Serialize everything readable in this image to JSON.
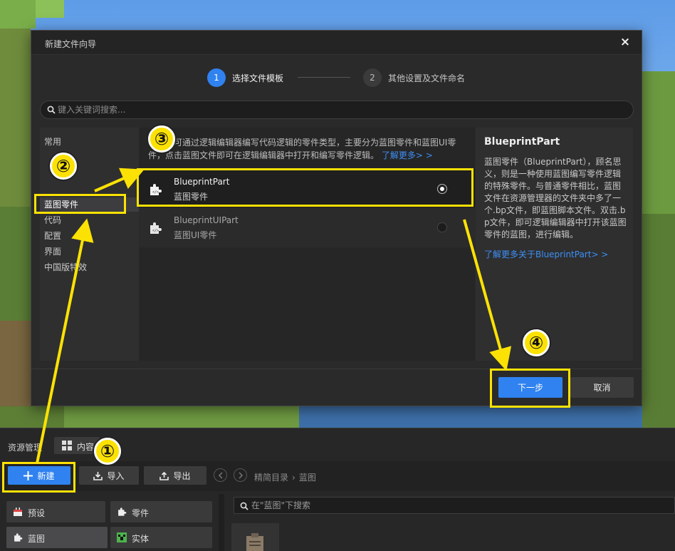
{
  "dialog": {
    "title": "新建文件向导",
    "close_label": "×",
    "steps": [
      {
        "num": "1",
        "label": "选择文件模板"
      },
      {
        "num": "2",
        "label": "其他设置及文件命名"
      }
    ],
    "search_placeholder": "键入关键词搜索...",
    "categories": [
      "常用",
      "蓝图零件",
      "代码",
      "配置",
      "界面",
      "中国版特效"
    ],
    "active_category": "蓝图零件",
    "list_description": "是一种可通过逻辑编辑器编写代码逻辑的零件类型，主要分为蓝图零件和蓝图UI零件，点击蓝图文件即可在逻辑编辑器中打开和编写零件逻辑。",
    "list_more_link": "了解更多> >",
    "templates": [
      {
        "name": "BlueprintPart",
        "subtitle": "蓝图零件",
        "selected": true
      },
      {
        "name": "BlueprintUIPart",
        "subtitle": "蓝图UI零件",
        "selected": false
      }
    ],
    "detail": {
      "title": "BlueprintPart",
      "body": "蓝图零件（BlueprintPart），顾名思义，则是一种使用蓝图编写零件逻辑的特殊零件。与普通零件相比，蓝图文件在资源管理器的文件夹中多了一个.bp文件，即蓝图脚本文件。双击.bp文件，即可逻辑编辑器中打开该蓝图零件的蓝图，进行编辑。",
      "link": "了解更多关于BlueprintPart> >"
    },
    "next_label": "下一步",
    "cancel_label": "取消"
  },
  "resource_panel": {
    "title": "资源管理",
    "tab_label": "内容",
    "toolbar": {
      "new_label": "新建",
      "import_label": "导入",
      "export_label": "导出"
    },
    "breadcrumb": [
      "精简目录",
      "蓝图"
    ],
    "categories": [
      {
        "label": "预设",
        "icon": "cake-icon"
      },
      {
        "label": "零件",
        "icon": "puzzle-icon"
      },
      {
        "label": "蓝图",
        "icon": "puzzle-icon"
      },
      {
        "label": "实体",
        "icon": "creeper-icon"
      }
    ],
    "search_placeholder": "在\"蓝图\"下搜索"
  },
  "annotations": {
    "badges": [
      "①",
      "②",
      "③",
      "④"
    ],
    "color": "#fce204"
  },
  "colors": {
    "accent": "#2f82ef",
    "link": "#3d8ff5",
    "dialog_bg": "#2a2a2b"
  }
}
